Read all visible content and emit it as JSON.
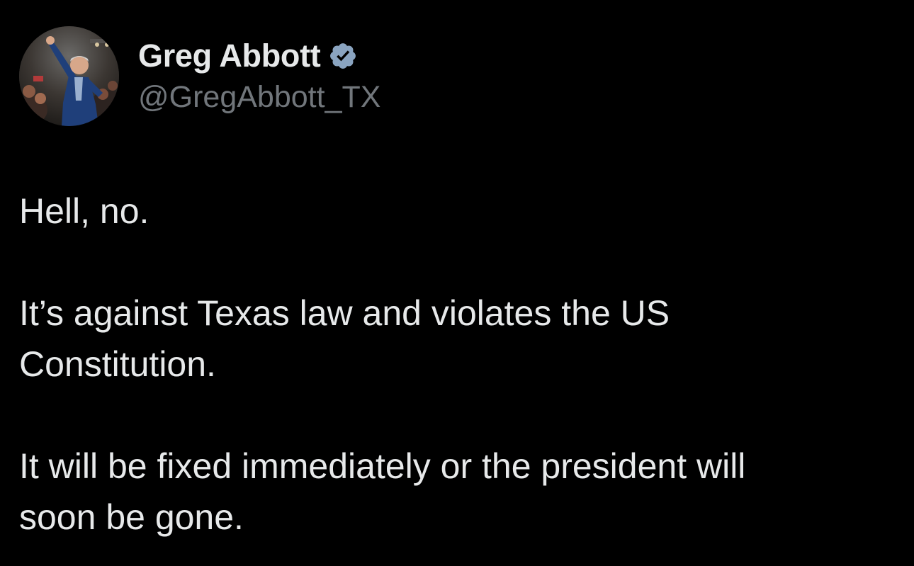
{
  "author": {
    "display_name": "Greg Abbott",
    "handle": "@GregAbbott_TX",
    "verified_icon": "verified-badge-icon",
    "verified_color": "#8aa4c0"
  },
  "tweet": {
    "paragraphs": [
      "Hell, no.",
      "It’s against Texas law and violates the US\nConstitution.",
      "It will be fixed immediately or the president will\nsoon be gone."
    ]
  },
  "colors": {
    "background": "#000000",
    "text": "#e7e9ea",
    "secondary_text": "#71767b"
  }
}
